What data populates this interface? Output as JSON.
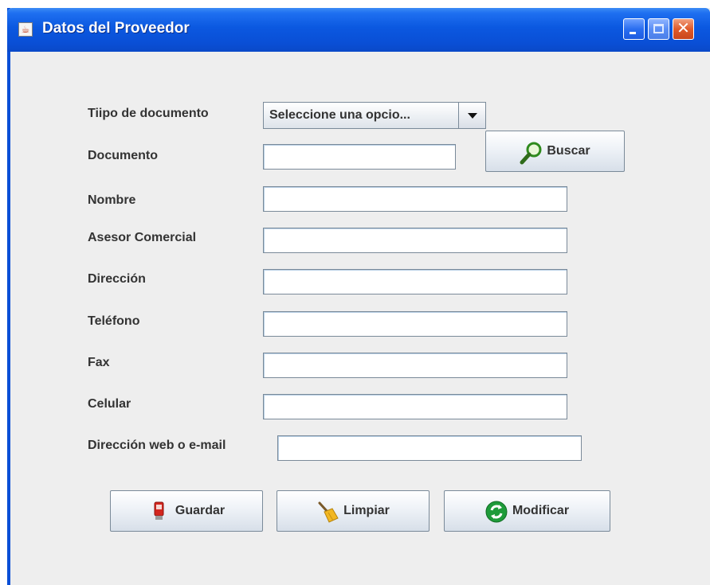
{
  "window": {
    "title": "Datos del Proveedor"
  },
  "form": {
    "tipo_documento": {
      "label": "Tiipo de documento",
      "selected": "Seleccione una opcio..."
    },
    "documento": {
      "label": "Documento",
      "value": ""
    },
    "buscar_label": "Buscar",
    "nombre": {
      "label": "Nombre",
      "value": ""
    },
    "asesor": {
      "label": "Asesor Comercial",
      "value": ""
    },
    "direccion": {
      "label": "Dirección",
      "value": ""
    },
    "telefono": {
      "label": "Teléfono",
      "value": ""
    },
    "fax": {
      "label": "Fax",
      "value": ""
    },
    "celular": {
      "label": "Celular",
      "value": ""
    },
    "web": {
      "label": "Dirección web o e-mail",
      "value": ""
    }
  },
  "actions": {
    "guardar": "Guardar",
    "limpiar": "Limpiar",
    "modificar": "Modificar"
  },
  "icons": {
    "window": "java-app-icon",
    "buscar": "magnifier-icon",
    "guardar": "save-icon",
    "limpiar": "broom-icon",
    "modificar": "refresh-icon"
  },
  "colors": {
    "titlebar": "#0a4fd6",
    "panel": "#eeeeee",
    "text": "#333333"
  }
}
